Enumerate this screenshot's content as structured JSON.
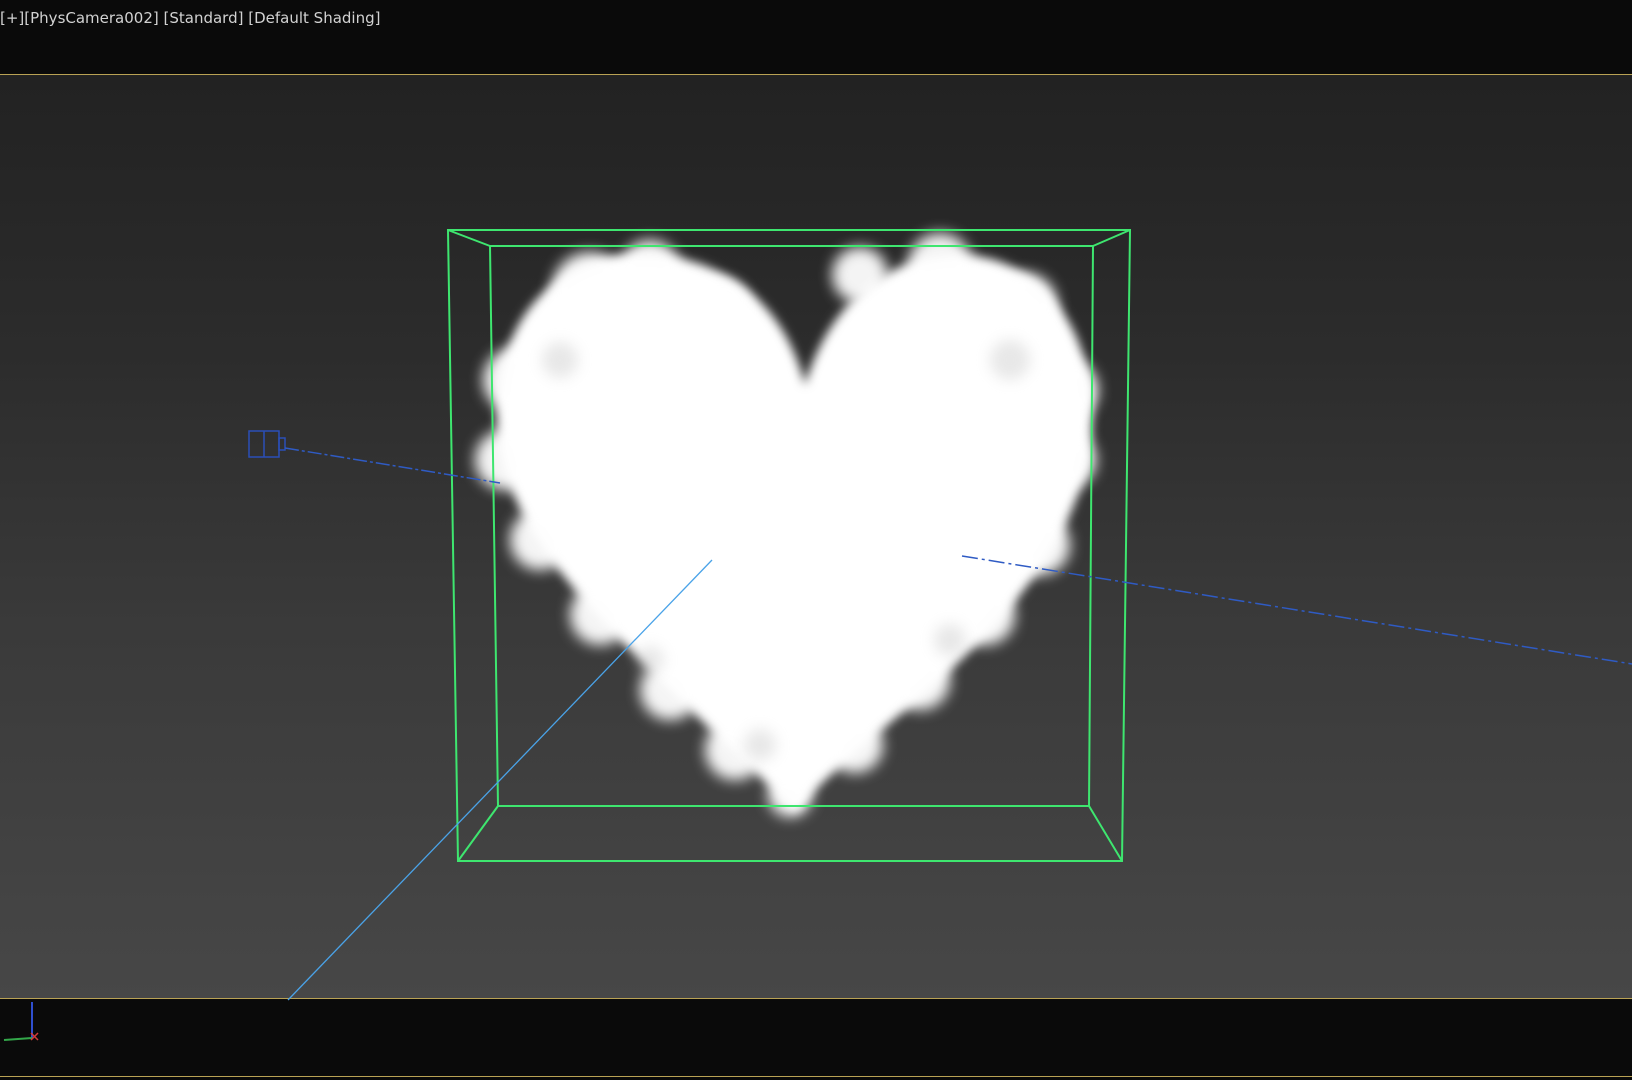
{
  "viewport": {
    "menu_label": "[+]",
    "camera_label": "[PhysCamera002]",
    "mode_label": "[Standard]",
    "shading_label": "[Default Shading]"
  },
  "colors": {
    "background_top": "#222222",
    "background_bottom": "#474747",
    "letterbox": "#0a0a0a",
    "safe_frame_line": "#b9a254",
    "bounding_box": "#3ee66f",
    "camera_line": "#2f5bc4",
    "target_line": "#4aa3e8",
    "cloud": "#ffffff"
  },
  "scene": {
    "object": "heart-shaped-cloud",
    "selection_box": "green-wireframe-cube",
    "camera_icon": "camera-icon",
    "axis_gizmo": "axis-tripod-icon"
  }
}
